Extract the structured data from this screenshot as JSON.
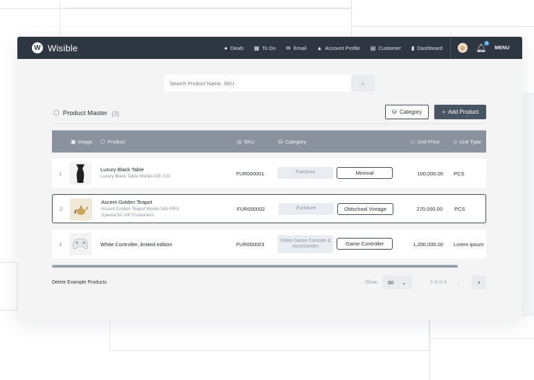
{
  "app": {
    "name": "Wisible"
  },
  "nav": {
    "items": [
      {
        "label": "Deals",
        "icon": "circle-dollar-icon"
      },
      {
        "label": "To Do",
        "icon": "calendar-icon"
      },
      {
        "label": "Email",
        "icon": "mail-icon"
      },
      {
        "label": "Account Profile",
        "icon": "user-icon"
      },
      {
        "label": "Customer",
        "icon": "building-icon"
      },
      {
        "label": "Dashboard",
        "icon": "bar-chart-icon"
      }
    ],
    "notification_count": "4",
    "menu_label": "MENU"
  },
  "search": {
    "placeholder": "Search Product Name, SKU"
  },
  "section": {
    "title": "Product Master",
    "count": "(3)",
    "category_button": "Category",
    "add_button": "Add Product"
  },
  "table": {
    "headers": {
      "image": "Image",
      "product": "Product",
      "sku": "SKU",
      "category": "Category",
      "unit_price": "Unit Price",
      "unit_type": "Unit Type"
    },
    "rows": [
      {
        "index": "1",
        "name": "Luxury Black Table",
        "subtitle": "Luxury Black Table Model-02E-123",
        "subtitle2": "",
        "sku": "FUR000001",
        "category": "Furniture",
        "tag": "Minimal",
        "price": "100,000.00",
        "unit": "PCS"
      },
      {
        "index": "2",
        "name": "Ascent Golden Teapot",
        "subtitle": "Ascent Golden Teapot Model-145-FRG",
        "subtitle2": "Special for VIP Customers",
        "sku": "FUR000002",
        "category": "Furniture",
        "tag": "Oldschool Vintage",
        "price": "270,000.00",
        "unit": "PCS"
      },
      {
        "index": "3",
        "name": "White Controller, limited edition",
        "subtitle": "",
        "subtitle2": "",
        "sku": "FUR000003",
        "category": "Video Game Console & Accessories",
        "tag": "Game Controller",
        "price": "1,200,000.00",
        "unit": "Lorem ipsum"
      }
    ]
  },
  "footer": {
    "delete_label": "Delete Example Products",
    "show_label": "Show",
    "page_size": "50",
    "range": "1-3 of 3"
  }
}
